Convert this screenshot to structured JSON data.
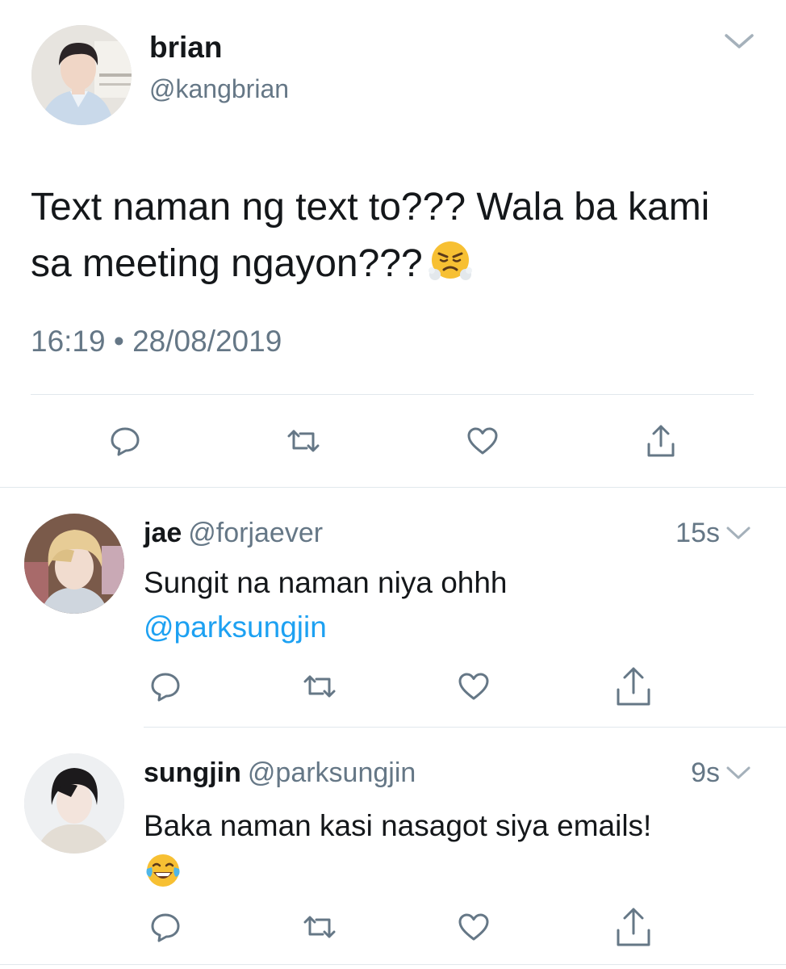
{
  "main_tweet": {
    "name": "brian",
    "handle": "@kangbrian",
    "text": "Text naman ng text to??? Wala ba kami sa meeting ngayon???",
    "emoji": "face-with-steam-from-nose",
    "timestamp": "16:19 • 28/08/2019",
    "actions": [
      "reply-icon",
      "retweet-icon",
      "like-icon",
      "share-icon"
    ]
  },
  "replies": [
    {
      "name": "jae",
      "handle": "@forjaever",
      "time": "15s",
      "text": "Sungit na naman niya ohhh",
      "mention": "@parksungjin"
    },
    {
      "name": "sungjin",
      "handle": "@parksungjin",
      "time": "9s",
      "text": "Baka naman kasi nasagot siya emails!",
      "emoji": "face-with-tears-of-joy"
    }
  ],
  "colors": {
    "text": "#14171a",
    "secondary": "#657786",
    "link": "#1da1f2",
    "divider": "#e1e8ed"
  }
}
